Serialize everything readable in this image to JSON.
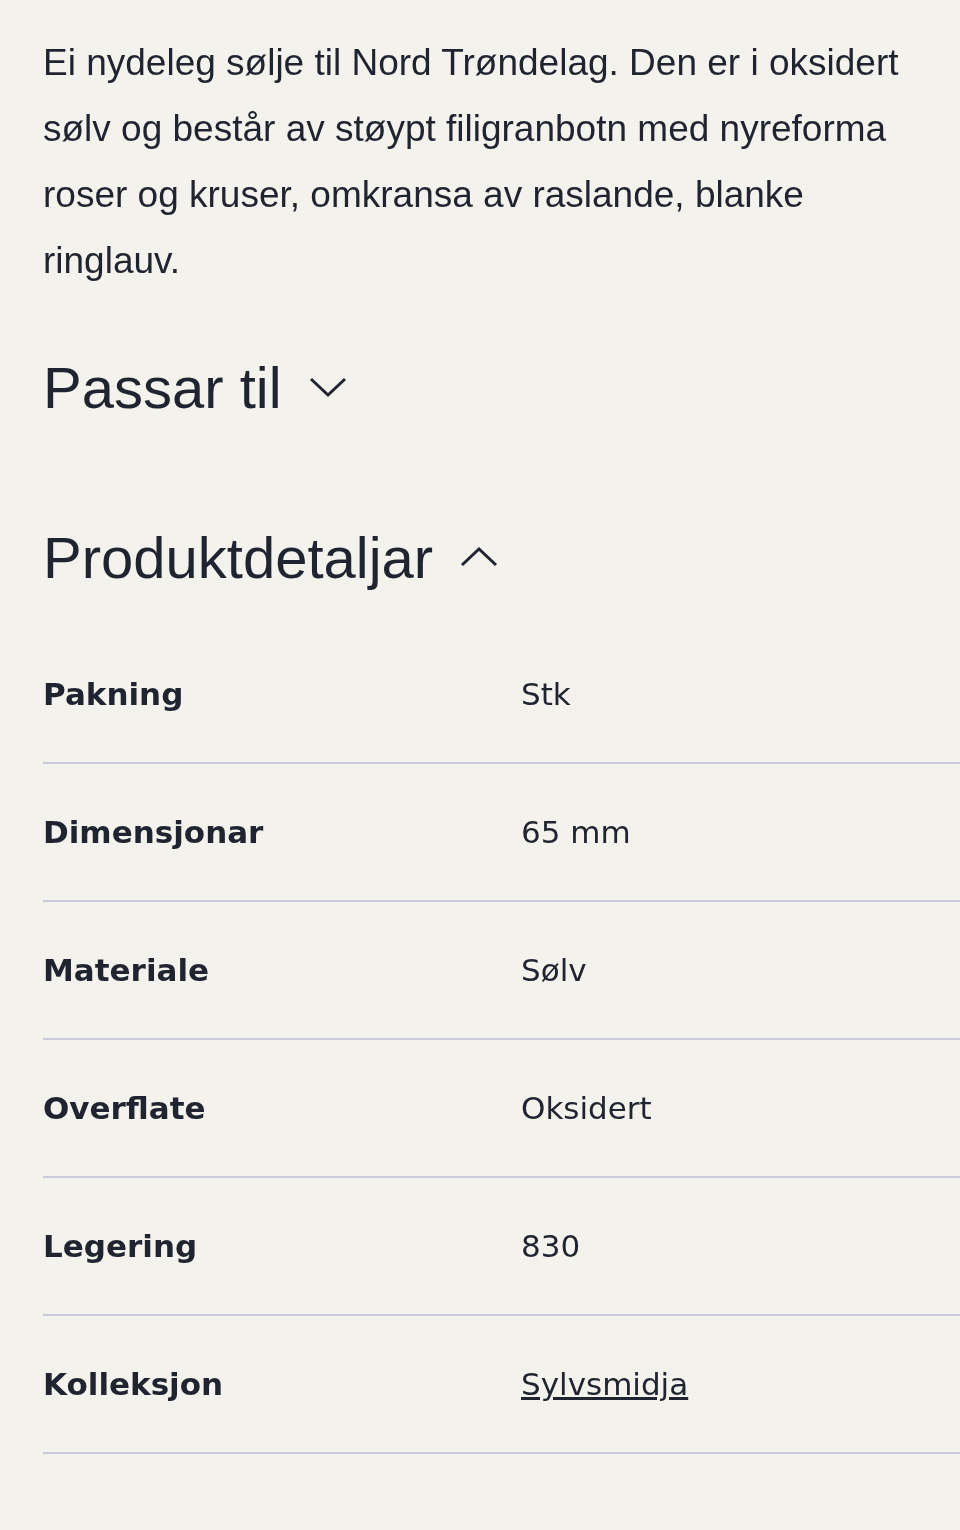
{
  "description": "Ei nydeleg sølje til Nord Trøndelag. Den er i oksidert sølv og består av støypt filigranbotn med nyreforma roser og kruser, omkransa av raslande, blanke ringlauv.",
  "sections": [
    {
      "title": "Passar til",
      "expanded": false
    },
    {
      "title": "Produktdetaljar",
      "expanded": true
    }
  ],
  "details": [
    {
      "label": "Pakning",
      "value": "Stk",
      "kind": "text"
    },
    {
      "label": "Dimensjonar",
      "value": "65 mm",
      "kind": "text"
    },
    {
      "label": "Materiale",
      "value": "Sølv",
      "kind": "text"
    },
    {
      "label": "Overflate",
      "value": "Oksidert",
      "kind": "text"
    },
    {
      "label": "Legering",
      "value": "830",
      "kind": "text"
    },
    {
      "label": "Kolleksjon",
      "value": "Sylvsmidja",
      "kind": "link"
    }
  ]
}
